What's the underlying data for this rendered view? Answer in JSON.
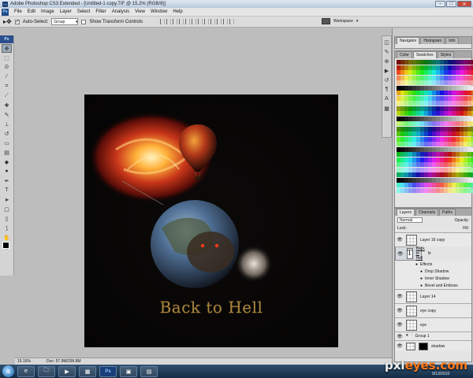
{
  "window": {
    "title": "Adobe Photoshop CS3 Extended - [Untitled-1 copy.TIF @ 15.2% (RGB/8)]",
    "minimize": "–",
    "maximize": "□",
    "close": "✕"
  },
  "menu": [
    "File",
    "Edit",
    "Image",
    "Layer",
    "Select",
    "Filter",
    "Analysis",
    "View",
    "Window",
    "Help"
  ],
  "options": {
    "auto_select_label": "Auto-Select:",
    "auto_select_value": "Group",
    "show_transform_label": "Show Transform Controls",
    "workspace_label": "Workspace"
  },
  "toolbox": {
    "header": "Ps",
    "tools": [
      "move-icon",
      "marquee-icon",
      "lasso-icon",
      "magic-wand-icon",
      "crop-icon",
      "slice-icon",
      "healing-icon",
      "brush-icon",
      "stamp-icon",
      "history-brush-icon",
      "eraser-icon",
      "gradient-icon",
      "blur-icon",
      "dodge-icon",
      "pen-icon",
      "type-icon",
      "path-select-icon",
      "shape-icon",
      "notes-icon",
      "eyedropper-icon",
      "hand-icon",
      "zoom-icon"
    ],
    "fg_color": "#000000",
    "bg_color": "#c0251b"
  },
  "canvas": {
    "title": "Back to Hell"
  },
  "status": {
    "zoom": "15.16%",
    "doc": "Doc: 57.9M/299.8M"
  },
  "panels": {
    "top_tabs": [
      "Navigator",
      "Histogram",
      "Info"
    ],
    "swatch_tabs": [
      "Color",
      "Swatches",
      "Styles"
    ],
    "layer_tabs": [
      "Layers",
      "Channels",
      "Paths"
    ],
    "blend_mode": "Normal",
    "opacity_label": "Opacity:",
    "lock_label": "Lock:",
    "fill_label": "Fill:",
    "layers": [
      {
        "name": "Layer 16 copy",
        "type": "raster"
      },
      {
        "name": "Back to Hell",
        "type": "text",
        "fx": "fx"
      },
      {
        "name": "Layer 14",
        "type": "raster"
      },
      {
        "name": "eye copy",
        "type": "raster"
      },
      {
        "name": "eye",
        "type": "raster"
      },
      {
        "name": "Group 1",
        "type": "group"
      },
      {
        "name": "shadow",
        "type": "raster"
      }
    ],
    "effects_label": "Effects",
    "effects": [
      "Drop Shadow",
      "Inner Shadow",
      "Bevel and Emboss"
    ]
  },
  "taskbar": {
    "time": "",
    "date": "9/13/2010"
  },
  "watermark": {
    "prefix": "pxl",
    "suffix": "eyes.com"
  }
}
